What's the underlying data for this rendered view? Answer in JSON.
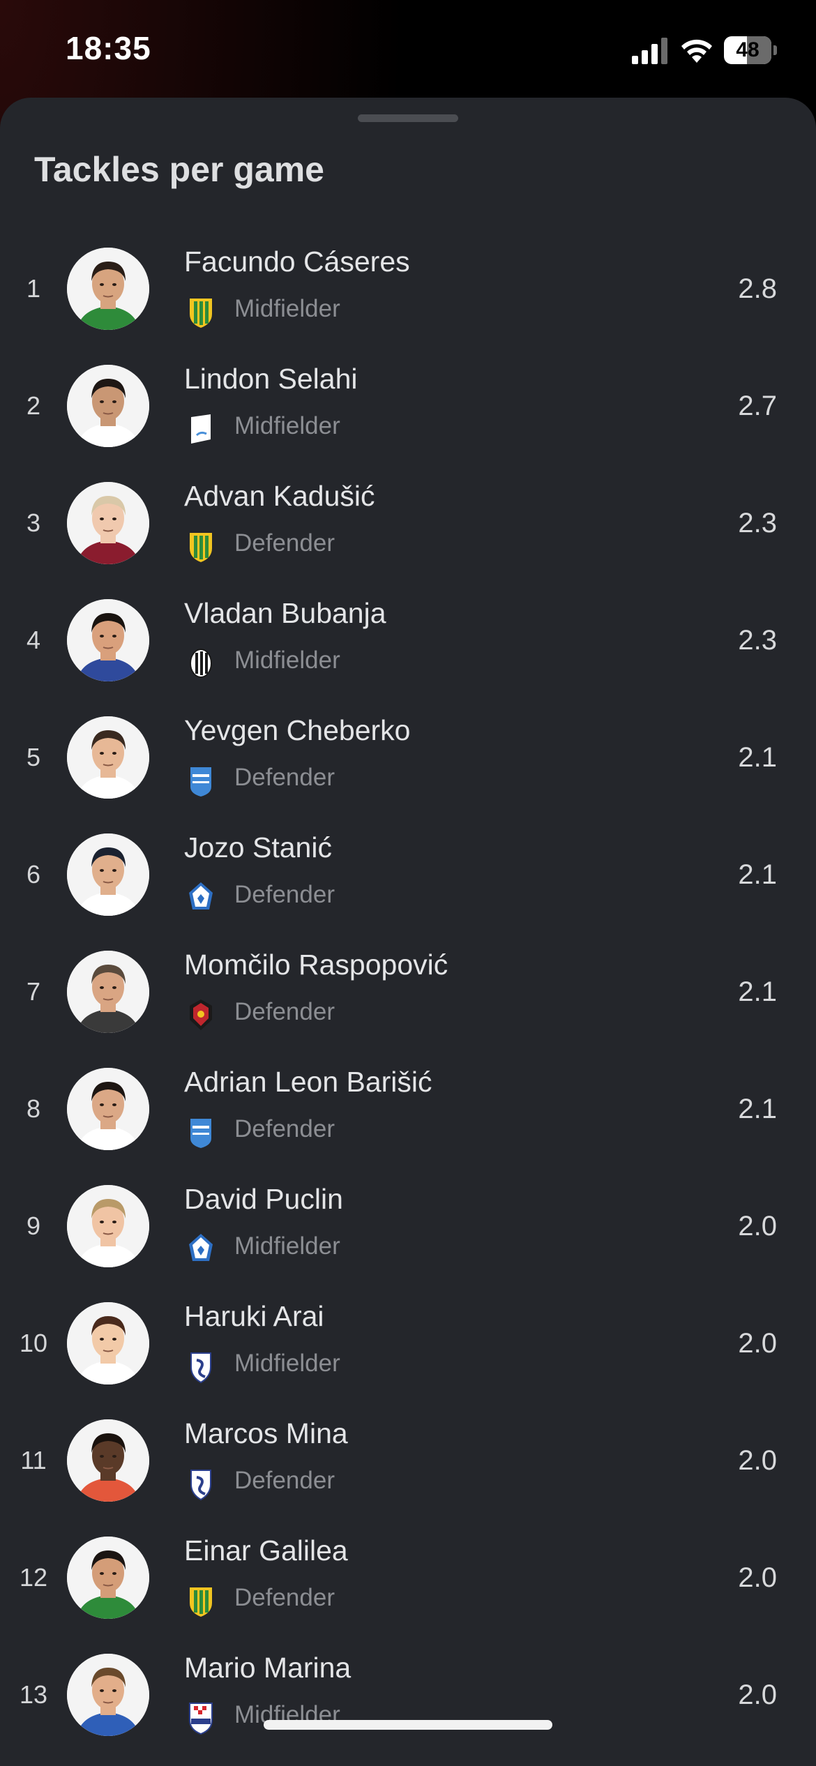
{
  "status_bar": {
    "time": "18:35",
    "battery": "48"
  },
  "sheet": {
    "title": "Tackles per game"
  },
  "players": [
    {
      "rank": "1",
      "name": "Facundo Cáseres",
      "position": "Midfielder",
      "value": "2.8",
      "badge": "yellow-green-shield-badge",
      "badge_colors": [
        "#f2c521",
        "#2e8b3a"
      ],
      "skin": "#d7a47f",
      "hair": "#2a1e17",
      "shirt": "#2e8b3a"
    },
    {
      "rank": "2",
      "name": "Lindon Selahi",
      "position": "Midfielder",
      "value": "2.7",
      "badge": "white-blue-flag-badge",
      "badge_colors": [
        "#ffffff",
        "#4a90d9"
      ],
      "skin": "#c99774",
      "hair": "#1e1714",
      "shirt": "#ffffff"
    },
    {
      "rank": "3",
      "name": "Advan Kadušić",
      "position": "Defender",
      "value": "2.3",
      "badge": "yellow-green-shield-badge",
      "badge_colors": [
        "#f2c521",
        "#2e8b3a"
      ],
      "skin": "#f0c9ae",
      "hair": "#d9c8a8",
      "shirt": "#8a1c2e"
    },
    {
      "rank": "4",
      "name": "Vladan Bubanja",
      "position": "Midfielder",
      "value": "2.3",
      "badge": "black-white-stripes-badge",
      "badge_colors": [
        "#ffffff",
        "#1a1a1a"
      ],
      "skin": "#d9a07c",
      "hair": "#1a1410",
      "shirt": "#2f4a9c"
    },
    {
      "rank": "5",
      "name": "Yevgen Cheberko",
      "position": "Defender",
      "value": "2.1",
      "badge": "blue-white-shield-badge",
      "badge_colors": [
        "#3f88d6",
        "#ffffff"
      ],
      "skin": "#e7b896",
      "hair": "#3a2a20",
      "shirt": "#ffffff"
    },
    {
      "rank": "6",
      "name": "Jozo Stanić",
      "position": "Defender",
      "value": "2.1",
      "badge": "blue-white-diamond-badge",
      "badge_colors": [
        "#ffffff",
        "#2d6fc4"
      ],
      "skin": "#e0af8c",
      "hair": "#1b2230",
      "shirt": "#ffffff"
    },
    {
      "rank": "7",
      "name": "Momčilo Raspopović",
      "position": "Defender",
      "value": "2.1",
      "badge": "red-black-crest-badge",
      "badge_colors": [
        "#c0262d",
        "#1a1a1a"
      ],
      "skin": "#d9a583",
      "hair": "#5a4a3c",
      "shirt": "#3a3a3a"
    },
    {
      "rank": "8",
      "name": "Adrian Leon Barišić",
      "position": "Defender",
      "value": "2.1",
      "badge": "blue-white-shield-badge",
      "badge_colors": [
        "#3f88d6",
        "#ffffff"
      ],
      "skin": "#dba886",
      "hair": "#1d1612",
      "shirt": "#ffffff"
    },
    {
      "rank": "9",
      "name": "David Puclin",
      "position": "Midfielder",
      "value": "2.0",
      "badge": "blue-white-diamond-badge",
      "badge_colors": [
        "#ffffff",
        "#2d6fc4"
      ],
      "skin": "#f0c4a4",
      "hair": "#b99a68",
      "shirt": "#ffffff"
    },
    {
      "rank": "10",
      "name": "Haruki Arai",
      "position": "Midfielder",
      "value": "2.0",
      "badge": "navy-white-shield-badge",
      "badge_colors": [
        "#ffffff",
        "#2b3f8c"
      ],
      "skin": "#f2caa8",
      "hair": "#4a2a1c",
      "shirt": "#ffffff"
    },
    {
      "rank": "11",
      "name": "Marcos Mina",
      "position": "Defender",
      "value": "2.0",
      "badge": "navy-white-shield-badge",
      "badge_colors": [
        "#ffffff",
        "#2b3f8c"
      ],
      "skin": "#5a3a28",
      "hair": "#1a120e",
      "shirt": "#e3573b"
    },
    {
      "rank": "12",
      "name": "Einar Galilea",
      "position": "Defender",
      "value": "2.0",
      "badge": "yellow-green-shield-badge",
      "badge_colors": [
        "#f2c521",
        "#2e8b3a"
      ],
      "skin": "#d49d78",
      "hair": "#1b1512",
      "shirt": "#2e8b3a"
    },
    {
      "rank": "13",
      "name": "Mario Marina",
      "position": "Midfielder",
      "value": "2.0",
      "badge": "red-white-checker-badge",
      "badge_colors": [
        "#d6272e",
        "#2b3f8c"
      ],
      "skin": "#e2ae8a",
      "hair": "#6a4a2c",
      "shirt": "#2f5fb8"
    }
  ]
}
